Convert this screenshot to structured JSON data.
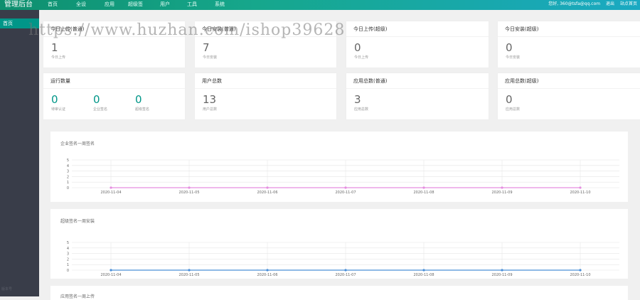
{
  "header": {
    "brand": "管理后台",
    "nav": [
      "首页",
      "全设",
      "应用",
      "超级签",
      "用户",
      "工具",
      "系统"
    ],
    "user": "您好, 360@tsfa@qq.com",
    "link_logout": "退出",
    "link_site": "站点首页"
  },
  "sidebar": {
    "active_item": "首页",
    "footer": "版本号"
  },
  "stats_row1": [
    {
      "title": "今日上传(普通)",
      "value": "1",
      "label": "今日上传"
    },
    {
      "title": "今日安装(普通)",
      "value": "7",
      "label": "今日安装"
    },
    {
      "title": "今日上传(超级)",
      "value": "0",
      "label": "今日上传"
    },
    {
      "title": "今日安装(超级)",
      "value": "0",
      "label": "今日安装"
    }
  ],
  "running": {
    "title": "运行数量",
    "items": [
      {
        "value": "0",
        "label": "待审认证"
      },
      {
        "value": "0",
        "label": "企业签名"
      },
      {
        "value": "0",
        "label": "超级签名"
      }
    ]
  },
  "stats_row2": [
    {
      "title": "用户总数",
      "value": "13",
      "label": "用户总数"
    },
    {
      "title": "应用总数(普通)",
      "value": "3",
      "label": "应用总数"
    },
    {
      "title": "应用总数(超级)",
      "value": "0",
      "label": "应用总数"
    }
  ],
  "colors": {
    "accent": "#009688",
    "header_gradient_start": "#0e8f6e",
    "header_gradient_end": "#1aa9c2",
    "sidebar": "#393d49",
    "series_pink": "#e58ee0",
    "series_blue": "#4b8fd8"
  },
  "chart_data": [
    {
      "type": "line",
      "title": "企业签名一周签名",
      "x": [
        "2020-11-04",
        "2020-11-05",
        "2020-11-06",
        "2020-11-07",
        "2020-11-08",
        "2020-11-09",
        "2020-11-10"
      ],
      "series": [
        {
          "values": [
            0,
            0,
            0,
            0,
            0,
            0,
            0
          ],
          "color": "#e58ee0"
        }
      ],
      "ylim": [
        0,
        5
      ],
      "yticks": [
        "0",
        "1",
        "2",
        "3",
        "4",
        "5"
      ],
      "grid": true
    },
    {
      "type": "line",
      "title": "超级签名一周安装",
      "x": [
        "2020-11-04",
        "2020-11-05",
        "2020-11-06",
        "2020-11-07",
        "2020-11-08",
        "2020-11-09",
        "2020-11-10"
      ],
      "series": [
        {
          "values": [
            0,
            0,
            0,
            0,
            0,
            0,
            0
          ],
          "color": "#4b8fd8"
        }
      ],
      "ylim": [
        0,
        5
      ],
      "yticks": [
        "0",
        "1",
        "2",
        "3",
        "4",
        "5"
      ],
      "grid": true
    }
  ],
  "chart3_title": "应用签名一周上传",
  "watermark": "https://www.huzhan.com/ishop39628"
}
